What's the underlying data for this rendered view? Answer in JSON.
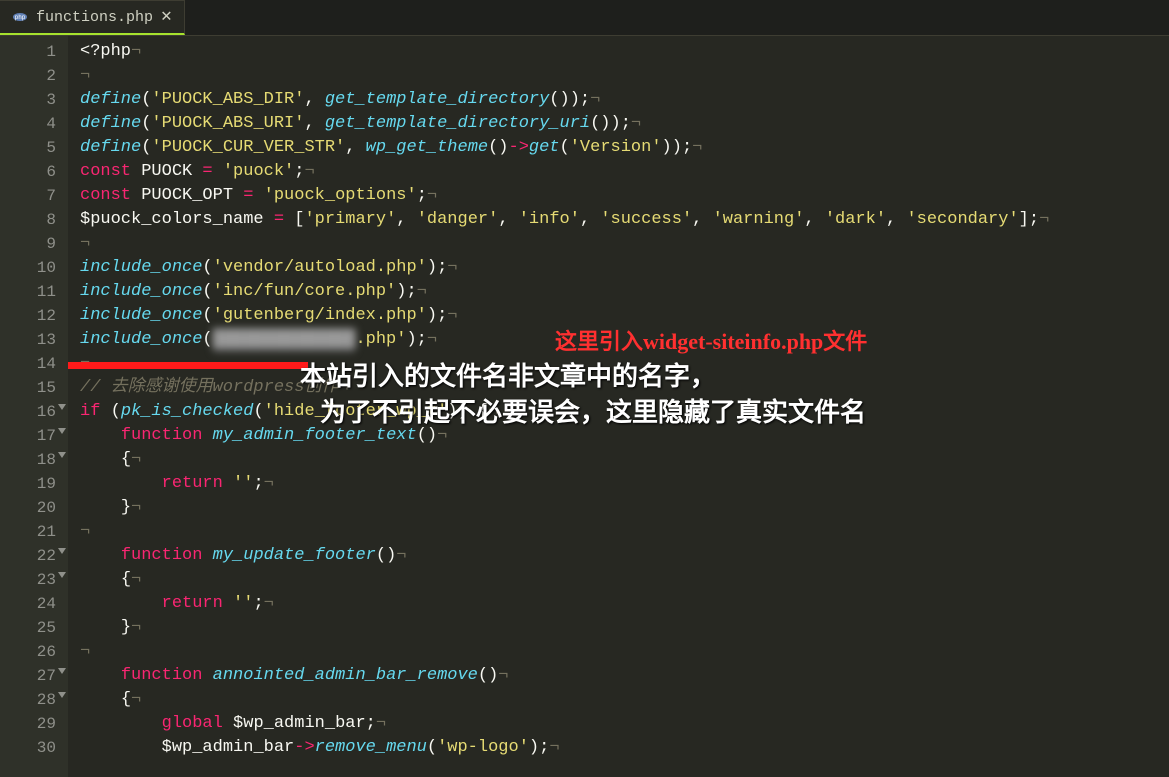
{
  "tab": {
    "filename": "functions.php",
    "close_glyph": "✕",
    "modified": true
  },
  "gutter": {
    "lines": [
      1,
      2,
      3,
      4,
      5,
      6,
      7,
      8,
      9,
      10,
      11,
      12,
      13,
      14,
      15,
      16,
      17,
      18,
      19,
      20,
      21,
      22,
      23,
      24,
      25,
      26,
      27,
      28,
      29,
      30
    ],
    "fold_lines": [
      16,
      17,
      18,
      22,
      23,
      27,
      28
    ]
  },
  "code": {
    "l1": {
      "a": "<?php",
      "nl": "¬"
    },
    "l2": {
      "nl": "¬"
    },
    "l3": {
      "fn": "define",
      "a": "(",
      "s1": "'PUOCK_ABS_DIR'",
      "b": ", ",
      "fn2": "get_template_directory",
      "c": "());",
      "nl": "¬"
    },
    "l4": {
      "fn": "define",
      "a": "(",
      "s1": "'PUOCK_ABS_URI'",
      "b": ", ",
      "fn2": "get_template_directory_uri",
      "c": "());",
      "nl": "¬"
    },
    "l5": {
      "fn": "define",
      "a": "(",
      "s1": "'PUOCK_CUR_VER_STR'",
      "b": ", ",
      "fn2": "wp_get_theme",
      "c": "()",
      "op": "->",
      "fn3": "get",
      "d": "(",
      "s2": "'Version'",
      "e": "));",
      "nl": "¬"
    },
    "l6": {
      "kw": "const",
      "sp": " ",
      "nm": "PUOCK",
      "op": " = ",
      "s": "'puock'",
      "end": ";",
      "nl": "¬"
    },
    "l7": {
      "kw": "const",
      "sp": " ",
      "nm": "PUOCK_OPT",
      "op": " = ",
      "s": "'puock_options'",
      "end": ";",
      "nl": "¬"
    },
    "l8": {
      "var": "$puock_colors_name",
      "op": " = ",
      "a": "[",
      "s1": "'primary'",
      "b": ", ",
      "s2": "'danger'",
      "c": ", ",
      "s3": "'info'",
      "d": ", ",
      "s4": "'success'",
      "e": ", ",
      "s5": "'warning'",
      "f": ", ",
      "s6": "'dark'",
      "g": ", ",
      "s7": "'secondary'",
      "h": "];",
      "nl": "¬"
    },
    "l9": {
      "nl": "¬"
    },
    "l10": {
      "fn": "include_once",
      "a": "(",
      "s": "'vendor/autoload.php'",
      "b": ");",
      "nl": "¬"
    },
    "l11": {
      "fn": "include_once",
      "a": "(",
      "s": "'inc/fun/core.php'",
      "b": ");",
      "nl": "¬"
    },
    "l12": {
      "fn": "include_once",
      "a": "(",
      "s": "'gutenberg/index.php'",
      "b": ");",
      "nl": "¬"
    },
    "l13": {
      "fn": "include_once",
      "a": "(",
      "blur": "██████████████",
      "ext": ".php'",
      "b": ");",
      "nl": "¬"
    },
    "l14": {
      "nl": "¬"
    },
    "l15": {
      "c": "// 去除感谢使用wordpress创作",
      "nl": "¬"
    },
    "l16": {
      "kw": "if",
      "sp": " (",
      "fn": "pk_is_checked",
      "a": "(",
      "s": "'hide_footer_wp_t'",
      "b": ")) {",
      "nl": "¬"
    },
    "l17": {
      "indent": "    ",
      "kw": "function",
      "sp": " ",
      "fn": "my_admin_footer_text",
      "a": "()",
      "nl": "¬"
    },
    "l18": {
      "indent": "    ",
      "a": "{",
      "nl": "¬"
    },
    "l19": {
      "indent": "        ",
      "kw": "return",
      "sp": " ",
      "s": "''",
      "a": ";",
      "nl": "¬"
    },
    "l20": {
      "indent": "    ",
      "a": "}",
      "nl": "¬"
    },
    "l21": {
      "nl": "¬"
    },
    "l22": {
      "indent": "    ",
      "kw": "function",
      "sp": " ",
      "fn": "my_update_footer",
      "a": "()",
      "nl": "¬"
    },
    "l23": {
      "indent": "    ",
      "a": "{",
      "nl": "¬"
    },
    "l24": {
      "indent": "        ",
      "kw": "return",
      "sp": " ",
      "s": "''",
      "a": ";",
      "nl": "¬"
    },
    "l25": {
      "indent": "    ",
      "a": "}",
      "nl": "¬"
    },
    "l26": {
      "nl": "¬"
    },
    "l27": {
      "indent": "    ",
      "kw": "function",
      "sp": " ",
      "fn": "annointed_admin_bar_remove",
      "a": "()",
      "nl": "¬"
    },
    "l28": {
      "indent": "    ",
      "a": "{",
      "nl": "¬"
    },
    "l29": {
      "indent": "        ",
      "kw": "global",
      "sp": " ",
      "var": "$wp_admin_bar",
      "a": ";",
      "nl": "¬"
    },
    "l30": {
      "indent": "        ",
      "var": "$wp_admin_bar",
      "op": "->",
      "fn": "remove_menu",
      "a": "(",
      "s": "'wp-logo'",
      "b": ");",
      "nl": "¬"
    }
  },
  "annotations": {
    "red_note": "这里引入widget-siteinfo.php文件",
    "white_line1": "本站引入的文件名非文章中的名字，",
    "white_line2": "为了不引起不必要误会，这里隐藏了真实文件名"
  }
}
